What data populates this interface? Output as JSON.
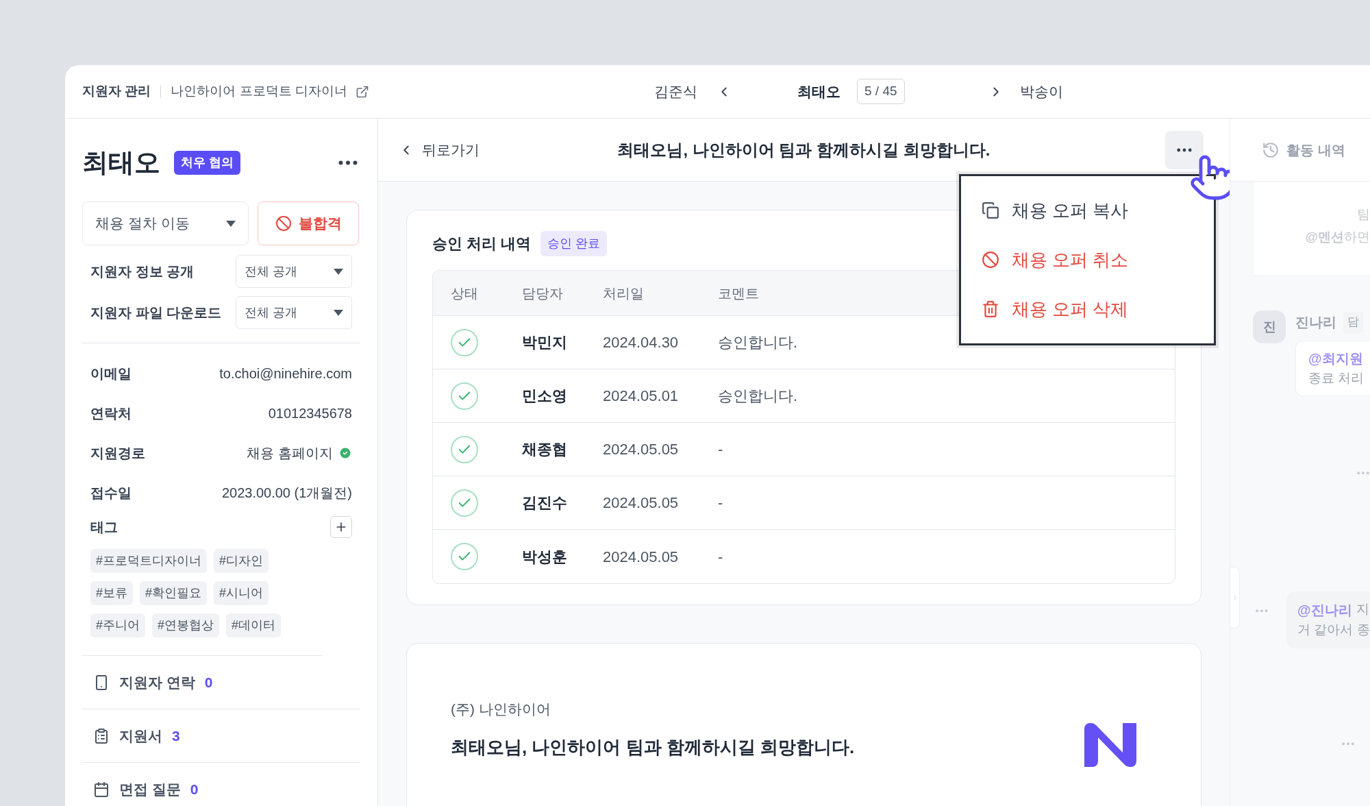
{
  "breadcrumb": {
    "section": "지원자 관리",
    "job": "나인하이어 프로덕트 디자이너"
  },
  "navigator": {
    "previous": "김준식",
    "current": "최태오",
    "position": "5 / 45",
    "next": "박송이"
  },
  "candidate": {
    "name": "최태오",
    "status_badge": "처우 협의",
    "stage_select": {
      "value": "채용 절차 이동"
    },
    "reject_button": "불합격",
    "settings": [
      {
        "label": "지원자 정보 공개",
        "value": "전체 공개"
      },
      {
        "label": "지원자 파일 다운로드",
        "value": "전체 공개"
      }
    ],
    "fields": [
      {
        "label": "이메일",
        "value": "to.choi@ninehire.com",
        "verified": false
      },
      {
        "label": "연락처",
        "value": "01012345678",
        "verified": false
      },
      {
        "label": "지원경로",
        "value": "채용 홈페이지",
        "verified": true
      },
      {
        "label": "접수일",
        "value": "2023.00.00 (1개월전)",
        "verified": false
      }
    ],
    "tags_label": "태그",
    "tags": [
      "#프로덕트디자이너",
      "#디자인",
      "#보류",
      "#확인필요",
      "#시니어",
      "#주니어",
      "#연봉협상",
      "#데이터"
    ],
    "sections": [
      {
        "kind": "contact",
        "label": "지원자 연락",
        "count": "0"
      },
      {
        "kind": "application",
        "label": "지원서",
        "count": "3"
      },
      {
        "kind": "interview",
        "label": "면접 질문",
        "count": "0"
      }
    ]
  },
  "header": {
    "back": "뒤로가기",
    "title": "최태오님, 나인하이어 팀과 함께하시길 희망합니다."
  },
  "approval": {
    "title": "승인 처리 내역",
    "badge": "승인 완료",
    "columns": [
      "상태",
      "담당자",
      "처리일",
      "코멘트"
    ],
    "rows": [
      {
        "approved": true,
        "approver": "박민지",
        "date": "2024.04.30",
        "comment": "승인합니다."
      },
      {
        "approved": true,
        "approver": "민소영",
        "date": "2024.05.01",
        "comment": "승인합니다."
      },
      {
        "approved": true,
        "approver": "채종협",
        "date": "2024.05.05",
        "comment": "-"
      },
      {
        "approved": true,
        "approver": "김진수",
        "date": "2024.05.05",
        "comment": "-"
      },
      {
        "approved": true,
        "approver": "박성훈",
        "date": "2024.05.05",
        "comment": "-"
      }
    ]
  },
  "offer_letter": {
    "company": "(주) 나인하이어",
    "heading": "최태오님, 나인하이어 팀과 함께하시길 희망합니다."
  },
  "menu": {
    "items": [
      {
        "kind": "copy",
        "label": "채용 오퍼 복사",
        "danger": false
      },
      {
        "kind": "cancel",
        "label": "채용 오퍼 취소",
        "danger": true
      },
      {
        "kind": "delete",
        "label": "채용 오퍼 삭제",
        "danger": true
      }
    ]
  },
  "activity": {
    "title": "활동 내역",
    "hint_lines": [
      "팀",
      "**@멘션**하면"
    ],
    "comment": {
      "avatar": "진",
      "author": "진나리",
      "role": "담",
      "mention": "@최지원",
      "text": "종료 처리"
    },
    "reply": {
      "mention": "@진나리",
      "text": "지",
      "line2": "거 같아서 종"
    }
  }
}
